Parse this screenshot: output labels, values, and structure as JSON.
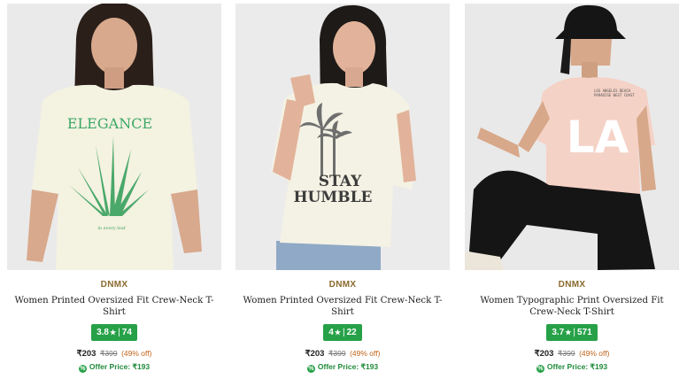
{
  "products": [
    {
      "brand": "DNMX",
      "title": "Women Printed Oversized Fit Crew-Neck T-Shirt",
      "rating": "3.8",
      "reviews": "74",
      "price": "₹203",
      "mrp": "₹399",
      "discount": "(49% off)",
      "offer": "Offer Price: ₹193",
      "print_text": "ELEGANCE",
      "print_sub": "in every leaf"
    },
    {
      "brand": "DNMX",
      "title": "Women Printed Oversized Fit Crew-Neck T-Shirt",
      "rating": "4",
      "reviews": "22",
      "price": "₹203",
      "mrp": "₹399",
      "discount": "(49% off)",
      "offer": "Offer Price: ₹193",
      "print_text_1": "STAY",
      "print_text_2": "HUMBLE"
    },
    {
      "brand": "DNMX",
      "title": "Women Typographic Print Oversized Fit Crew-Neck T-Shirt",
      "rating": "3.7",
      "reviews": "571",
      "price": "₹203",
      "mrp": "₹399",
      "discount": "(49% off)",
      "offer": "Offer Price: ₹193",
      "print_text": "LA",
      "print_small": "LOS ANGELES BEACH PARADISE WEST COAST"
    }
  ],
  "rating_star": "★",
  "rating_sep": "|",
  "offer_icon": "%",
  "colors": {
    "rating_bg": "#27a148",
    "brand": "#8a6a2e",
    "discount": "#c0641a",
    "offer": "#1f8b3a"
  }
}
